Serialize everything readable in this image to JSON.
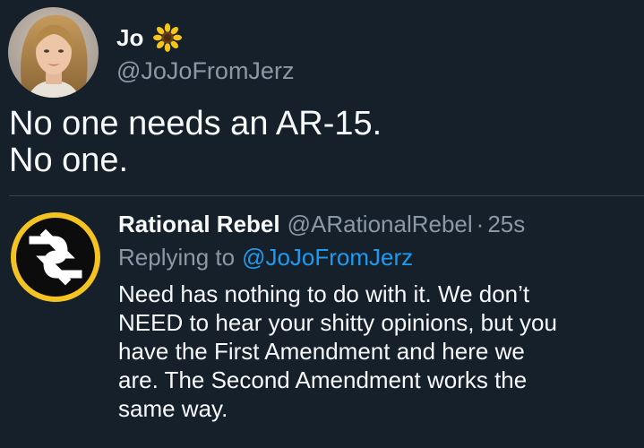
{
  "colors": {
    "background": "#15202b",
    "primary_text": "#f7f9f9",
    "secondary_text": "#8b98a5",
    "link": "#1d9bf0",
    "divider": "#38444d",
    "rr_avatar_ring": "#f4c322"
  },
  "original_tweet": {
    "author": {
      "display_name": "Jo",
      "badge_icon": "sunflower-icon",
      "handle": "@JoJoFromJerz",
      "avatar_icon": "profile-photo"
    },
    "text_lines": [
      "No one needs an AR-15.",
      "No one."
    ]
  },
  "reply": {
    "author": {
      "display_name": "Rational Rebel",
      "handle": "@ARationalRebel",
      "avatar_icon": "rr-logo-icon"
    },
    "separator": "·",
    "timestamp": "25s",
    "replying_to": {
      "prefix": "Replying to",
      "handle": "@JoJoFromJerz"
    },
    "text_lines": [
      "Need has nothing to do with it. We don’t",
      "NEED to hear your shitty opinions, but you",
      "have the First Amendment and here we",
      "are. The Second Amendment works the",
      "same way."
    ]
  }
}
